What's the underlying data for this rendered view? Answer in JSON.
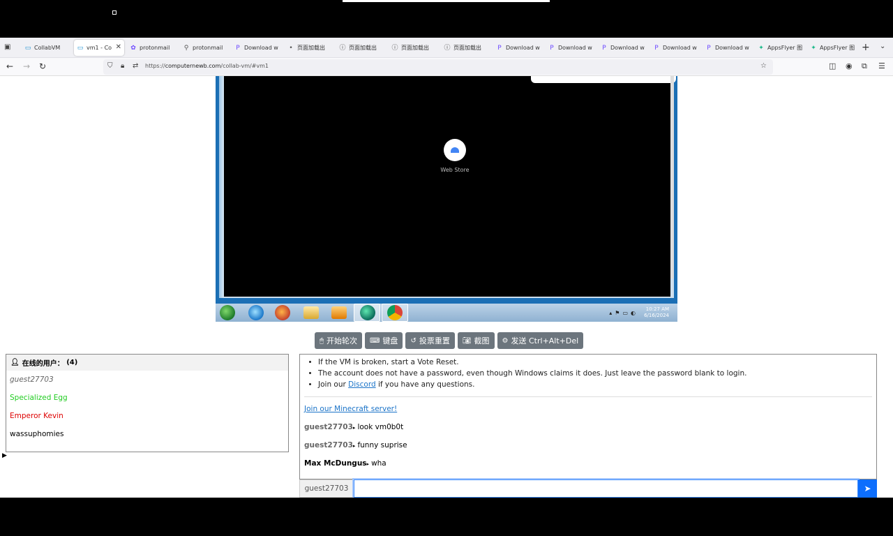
{
  "browser": {
    "tabs": [
      {
        "label": "CollabVM",
        "icon": "monitor-icon",
        "active": false
      },
      {
        "label": "vm1 - Co",
        "icon": "monitor-icon",
        "active": true
      },
      {
        "label": "protonmail",
        "icon": "gear-icon",
        "active": false
      },
      {
        "label": "protonmail",
        "icon": "search-icon",
        "active": false
      },
      {
        "label": "Download w",
        "icon": "p-icon",
        "active": false
      },
      {
        "label": "页面加载出",
        "icon": "dot-icon",
        "active": false
      },
      {
        "label": "页面加载出",
        "icon": "info-icon",
        "active": false
      },
      {
        "label": "页面加载出",
        "icon": "info-icon",
        "active": false
      },
      {
        "label": "页面加载出",
        "icon": "info-icon",
        "active": false
      },
      {
        "label": "Download w",
        "icon": "p-icon",
        "active": false
      },
      {
        "label": "Download w",
        "icon": "p-icon",
        "active": false
      },
      {
        "label": "Download w",
        "icon": "p-icon",
        "active": false
      },
      {
        "label": "Download w",
        "icon": "p-icon",
        "active": false
      },
      {
        "label": "Download w",
        "icon": "p-icon",
        "active": false
      },
      {
        "label": "AppsFlyer 图",
        "icon": "appsflyer-icon",
        "active": false
      },
      {
        "label": "AppsFlyer 图",
        "icon": "appsflyer-icon",
        "active": false
      }
    ],
    "url_prefix": "https://",
    "url_host": "computernewb.com",
    "url_path": "/collab-vm/#vm1"
  },
  "vm": {
    "webstore_label": "Web Store",
    "clock_time": "10:27 AM",
    "clock_date": "6/16/2024"
  },
  "controls": {
    "take_turn": "开始轮次",
    "keyboard": "键盘",
    "vote_reset": "投票重置",
    "screenshot": "截图",
    "ctrl_alt_del": "发送 Ctrl+Alt+Del"
  },
  "users": {
    "header_label": "在线的用户：",
    "count": "(4)",
    "list": [
      {
        "name": "guest27703",
        "color": "#666666"
      },
      {
        "name": "Specialized Egg",
        "color": "#22cc22"
      },
      {
        "name": "Emperor Kevin",
        "color": "#dd0000"
      },
      {
        "name": "wassuphomies",
        "color": "#000000"
      }
    ]
  },
  "chat": {
    "rule1": "If the VM is broken, start a Vote Reset.",
    "rule2": "The account does not have a password, even though Windows claims it does. Just leave the password blank to login.",
    "rule3_pre": "Join our ",
    "rule3_link": "Discord",
    "rule3_post": " if you have any questions.",
    "minecraft_link": "Join our Minecraft server!",
    "messages": [
      {
        "user": "guest27703",
        "text": "look vm0b0t"
      },
      {
        "user": "guest27703",
        "text": "funny suprise"
      },
      {
        "user": "Max McDungus",
        "text": "wha"
      }
    ],
    "username": "guest27703",
    "input_value": "",
    "input_placeholder": ""
  }
}
